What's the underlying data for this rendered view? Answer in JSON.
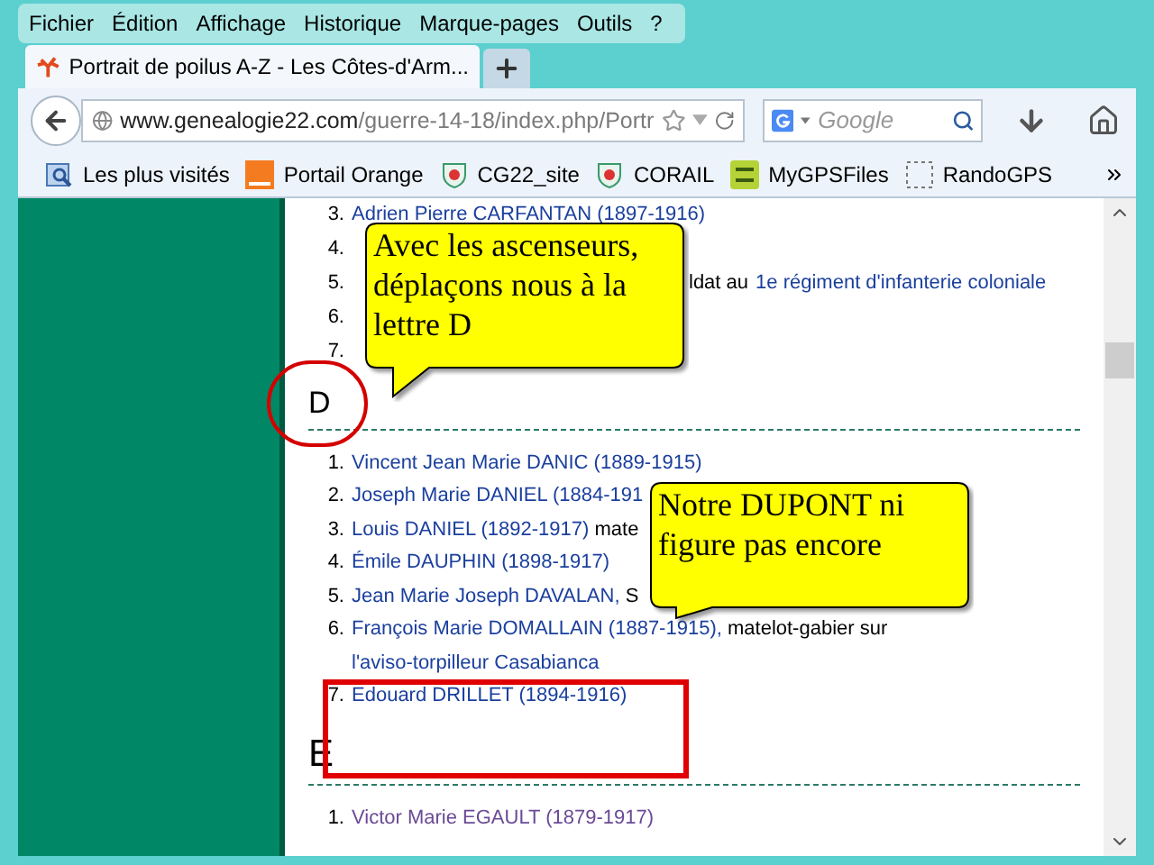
{
  "menu": [
    {
      "label": "Fichier"
    },
    {
      "label": "Édition"
    },
    {
      "label": "Affichage"
    },
    {
      "label": "Historique"
    },
    {
      "label": "Marque-pages"
    },
    {
      "label": "Outils"
    },
    {
      "label": "?"
    }
  ],
  "tab": {
    "title": "Portrait de poilus A-Z - Les Côtes-d'Arm...",
    "selected": true
  },
  "address": {
    "domain": "www.genealogie22.com",
    "path": "/guerre-14-18/index.php/Portr"
  },
  "search": {
    "placeholder": "Google"
  },
  "bookmarks": [
    {
      "label": "Les plus visités",
      "kind": "folder"
    },
    {
      "label": "Portail Orange",
      "kind": "orange"
    },
    {
      "label": "CG22_site",
      "kind": "crest"
    },
    {
      "label": "CORAIL",
      "kind": "crest"
    },
    {
      "label": "MyGPSFiles",
      "kind": "gps"
    },
    {
      "label": "RandoGPS",
      "kind": "blank"
    }
  ],
  "sections": [
    {
      "items": [
        {
          "kind": "entry",
          "number": "3.",
          "name": "Adrien Pierre CARFANTAN (1897-1916)",
          "visited": false
        },
        {
          "kind": "covered",
          "number": "4."
        },
        {
          "kind": "after_callout",
          "number": "5.",
          "note": "ldat au",
          "note_link": "1e régiment d'infanterie coloniale"
        },
        {
          "kind": "covered",
          "number": "6."
        },
        {
          "kind": "covered",
          "number": "7."
        }
      ]
    },
    {
      "heading": "D",
      "items": [
        {
          "kind": "entry",
          "number": "1.",
          "name": "Vincent Jean Marie DANIC (1889-1915)",
          "visited": false
        },
        {
          "kind": "entry",
          "number": "2.",
          "name": "Joseph Marie DANIEL (1884-191",
          "visited": false
        },
        {
          "kind": "entry",
          "number": "3.",
          "name": "Louis DANIEL (1892-1917)",
          "note": "mate",
          "visited": false
        },
        {
          "kind": "entry",
          "number": "4.",
          "name": "Émile DAUPHIN (1898-1917)",
          "visited": false
        },
        {
          "kind": "entry",
          "number": "5.",
          "name": "Jean Marie Joseph DAVALAN,",
          "note": "S",
          "visited": false
        },
        {
          "kind": "entry",
          "number": "6.",
          "name": "François Marie DOMALLAIN (1887-1915),",
          "note": "matelot-gabier sur",
          "note_link": "l'aviso-torpilleur Casabianca",
          "visited": false
        },
        {
          "kind": "entry",
          "number": "7.",
          "name": "Edouard DRILLET (1894-1916)",
          "visited": false
        }
      ]
    },
    {
      "heading": "E",
      "items": [
        {
          "kind": "entry",
          "number": "1.",
          "name": "Victor Marie EGAULT (1879-1917)",
          "visited": true
        }
      ]
    }
  ],
  "callouts": [
    {
      "text": "Avec les ascenseurs, déplaçons nous à la lettre D"
    },
    {
      "text": "Notre DUPONT ni figure pas encore"
    }
  ]
}
